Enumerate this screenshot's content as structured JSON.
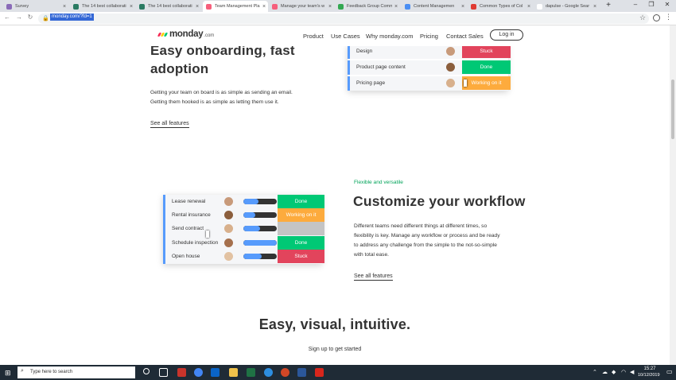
{
  "browser": {
    "tabs": [
      {
        "title": "Survey",
        "fav": "#8a6bb8"
      },
      {
        "title": "The 14 best collaborati",
        "fav": "#2a7a62"
      },
      {
        "title": "The 14 best collaborati",
        "fav": "#2a7a62"
      },
      {
        "title": "Team Management Pla",
        "fav": "#f65f7c"
      },
      {
        "title": "Manage your team's w",
        "fav": "#f65f7c"
      },
      {
        "title": "Feedback Group Comm",
        "fav": "#33a852"
      },
      {
        "title": "Content Managemen",
        "fav": "#4a8ef3"
      },
      {
        "title": "Common Types of Col",
        "fav": "#e03b33"
      },
      {
        "title": "dapulse - Google Sear",
        "fav": "#ffffff"
      }
    ],
    "new_tab": "+",
    "url": "monday.com/?fd=1"
  },
  "site": {
    "logo_word": "monday",
    "logo_suffix": ".com",
    "logo_colors": [
      "#f62b54",
      "#ffcc00",
      "#00ca72"
    ],
    "nav": [
      "Product",
      "Use Cases",
      "Why monday.com",
      "Pricing",
      "Contact Sales"
    ],
    "login": "Log in"
  },
  "section1": {
    "heading_line1": "Easy onboarding, fast",
    "heading_line2": "adoption",
    "body_line1": "Getting your team on board is as simple as sending an email.",
    "body_line2": "Getting them hooked is as simple as letting them use it.",
    "link": "See all features",
    "board": [
      {
        "name": "Design",
        "status": "Stuck",
        "color": "#e2445c"
      },
      {
        "name": "Product page content",
        "status": "Done",
        "color": "#00c875"
      },
      {
        "name": "Pricing page",
        "status": "Working on it",
        "color": "#fdab3d"
      }
    ]
  },
  "section2": {
    "tagline": "Flexible and versatile",
    "heading": "Customize your workflow",
    "body": [
      "Different teams need different things at different times, so",
      "flexibility is key. Manage any workflow or process and be ready",
      "to address any challenge from the simple to the not-so-simple",
      "with total ease."
    ],
    "link": "See all features",
    "board": [
      {
        "name": "Lease renewal",
        "status": "Done",
        "color": "#00c875",
        "progress": 0.45
      },
      {
        "name": "Rental insurance",
        "status": "Working on it",
        "color": "#fdab3d",
        "progress": 0.35
      },
      {
        "name": "Send contract",
        "status": "",
        "color": "#c4c4c4",
        "progress": 0.5
      },
      {
        "name": "Schedule inspection",
        "status": "Done",
        "color": "#00c875",
        "progress": 1.0
      },
      {
        "name": "Open house",
        "status": "Stuck",
        "color": "#e2445c",
        "progress": 0.55
      }
    ]
  },
  "section3": {
    "heading": "Easy, visual, intuitive.",
    "sub": "Sign up to get started"
  },
  "taskbar": {
    "search_placeholder": "Type here to search",
    "time": "15:27",
    "date": "10/12/2019"
  }
}
